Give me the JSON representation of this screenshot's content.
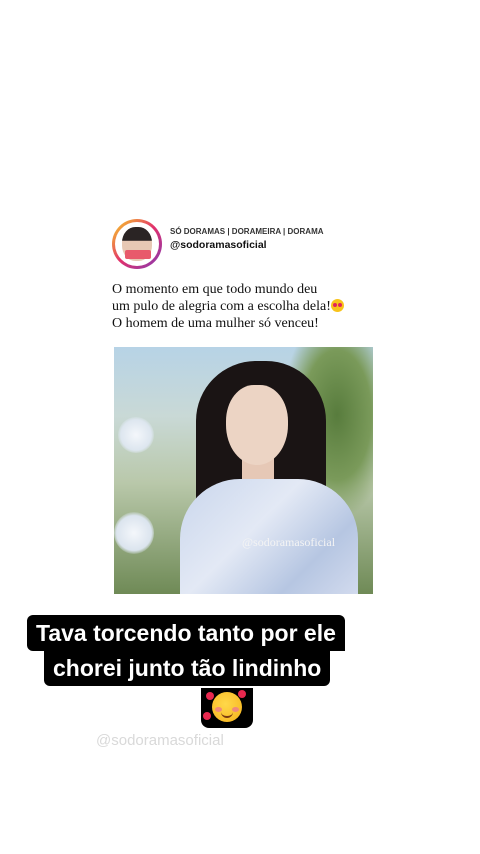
{
  "post": {
    "account_name": "SÓ DORAMAS | DORAMEIRA | DORAMA",
    "handle": "@sodoramasoficial",
    "caption_lines": [
      "O momento em que todo mundo deu",
      "um pulo de alegria com a escolha dela!",
      "O homem de uma mulher só venceu!"
    ],
    "caption_emoji": "smiling-face-with-heart-eyes",
    "media_watermark": "@sodoramasoficial"
  },
  "story_caption": {
    "line1": "Tava torcendo tanto por ele",
    "line2": "chorei junto tão lindinho",
    "emoji": "smiling-face-with-hearts"
  },
  "bottom_watermark": "@sodoramasoficial"
}
